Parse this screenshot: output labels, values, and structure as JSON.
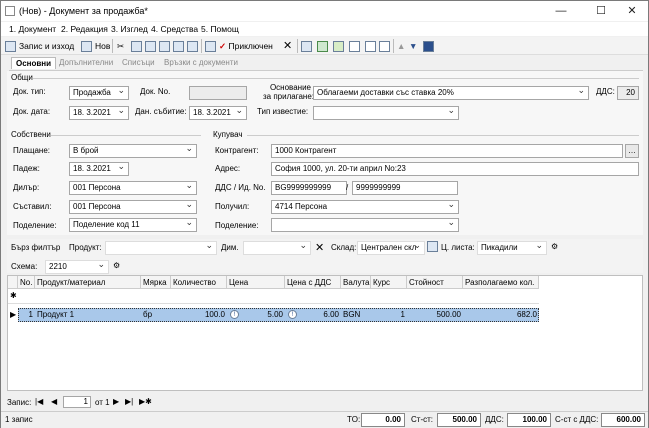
{
  "window": {
    "title": "(Нов) - Документ за продажба*",
    "min": "—",
    "max": "☐",
    "close": "✕"
  },
  "menu": [
    "1. Документ",
    "2. Редакция",
    "3. Изглед",
    "4. Средства",
    "5. Помощ"
  ],
  "toolbar": {
    "save_close": "Запис и изход",
    "new": "Нов",
    "posted": "Приключен"
  },
  "tabs": [
    "Основни",
    "Допълнителни",
    "Списъци",
    "Връзки с документи"
  ],
  "general": {
    "heading": "Общи",
    "doc_type_label": "Док. тип:",
    "doc_type": "Продажба",
    "doc_no_label": "Док. No.",
    "doc_no": "",
    "basis_label_1": "Основание",
    "basis_label_2": "за прилагане:",
    "basis": "Облагаеми доставки със ставка 20%",
    "vat_label": "ДДС:",
    "vat": "20",
    "doc_date_label": "Док. дата:",
    "doc_date": "18. 3.2021",
    "tax_event_label": "Дан. събитие:",
    "tax_event": "18. 3.2021",
    "notice_label": "Тип известие:",
    "notice": ""
  },
  "own": {
    "heading": "Собствени",
    "payment_label": "Плащане:",
    "payment": "В брой",
    "due_label": "Падеж:",
    "due": "18. 3.2021",
    "dealer_label": "Дилър:",
    "dealer": "001 Персона",
    "author_label": "Съставил:",
    "author": "001 Персона",
    "division_label": "Поделение:",
    "division": "Поделение код 11"
  },
  "buyer": {
    "heading": "Купувач",
    "contragent_label": "Контрагент:",
    "contragent": "1000 Контрагент",
    "address_label": "Адрес:",
    "address": "София 1000, ул. 20-ти април No:23",
    "vat_id_label": "ДДС / Ид. No.",
    "vat_no": "BG9999999999",
    "slash": "/",
    "id_no": "9999999999",
    "receiver_label": "Получил:",
    "receiver": "4714 Персона",
    "division_label": "Поделение:",
    "division": ""
  },
  "filter": {
    "quick_filter": "Бърз филтър",
    "product_label": "Продукт:",
    "product": "",
    "dim_label": "Дим.",
    "dim": "",
    "store_label": "Склад:",
    "store": "Централен скл",
    "price_list_label": "Ц. листа:",
    "price_list": "Пикадили",
    "scheme_label": "Схема:",
    "scheme": "2210"
  },
  "grid": {
    "headers": [
      "No.",
      "Продукт/материал",
      "Мярка",
      "Количество",
      "Цена",
      "Цена с ДДС",
      "Валута",
      "Курс",
      "Стойност",
      "Разполагаемо кол."
    ],
    "new_row_marker": "✱",
    "rows": [
      {
        "no": "1",
        "product": "Продукт 1",
        "unit": "бр",
        "qty": "100.0",
        "price": "5.00",
        "price_vat": "6.00",
        "currency": "BGN",
        "rate": "1",
        "value": "500.00",
        "available": "682.0"
      }
    ]
  },
  "navigator": {
    "label": "Запис:",
    "current": "1",
    "of": "от 1"
  },
  "status": {
    "records": "1 запис",
    "to_label": "TO:",
    "to": "0.00",
    "value_label": "Ст-ст:",
    "value": "500.00",
    "vat_label": "ДДС:",
    "vat": "100.00",
    "total_label": "С-ст с ДДС:",
    "total": "600.00"
  }
}
